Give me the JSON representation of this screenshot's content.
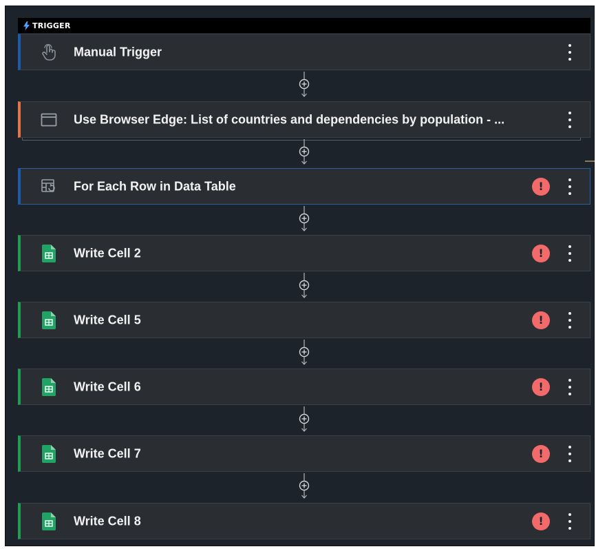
{
  "trigger_header": {
    "icon": "lightning-icon",
    "label": "TRIGGER"
  },
  "steps": [
    {
      "label": "Manual Trigger",
      "icon": "touch-icon",
      "accent": "#1f5ba6",
      "warning": false
    },
    {
      "label": "Use Browser Edge: List of countries and dependencies by population - ...",
      "icon": "browser-window-icon",
      "accent": "#e0744a",
      "warning": false
    },
    {
      "label": "For Each Row in Data Table",
      "icon": "table-loop-icon",
      "accent": "#1f5ba6",
      "warning": true
    },
    {
      "label": "Write Cell 2",
      "icon": "google-sheets-icon",
      "accent": "#1f9d55",
      "warning": true
    },
    {
      "label": "Write Cell 5",
      "icon": "google-sheets-icon",
      "accent": "#1f9d55",
      "warning": true
    },
    {
      "label": "Write Cell 6",
      "icon": "google-sheets-icon",
      "accent": "#1f9d55",
      "warning": true
    },
    {
      "label": "Write Cell 7",
      "icon": "google-sheets-icon",
      "accent": "#1f9d55",
      "warning": true
    },
    {
      "label": "Write Cell 8",
      "icon": "google-sheets-icon",
      "accent": "#1f9d55",
      "warning": true
    }
  ],
  "warning_symbol": "!",
  "colors": {
    "canvas": "#1d232b",
    "card": "#2a2d31",
    "warning": "#f36a6a",
    "sheets_green": "#21a366"
  }
}
